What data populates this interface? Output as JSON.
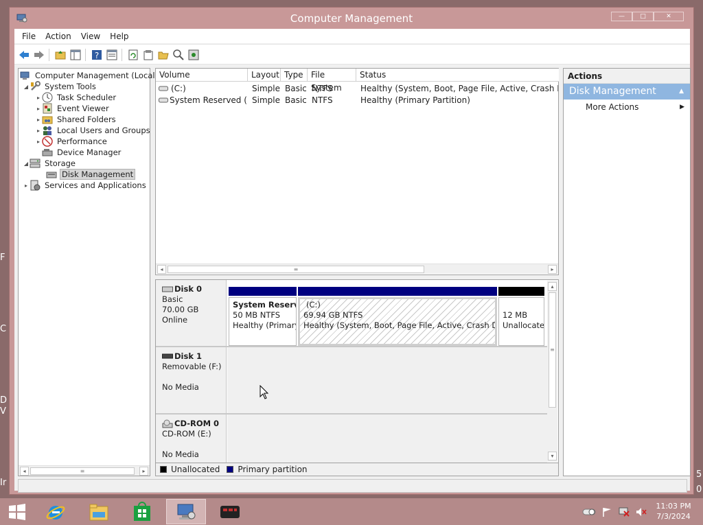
{
  "desktop": {
    "left_fragments": [
      "F",
      "C",
      "D",
      "V",
      "Ir"
    ],
    "right_fragments": [
      "5",
      "0"
    ]
  },
  "window": {
    "title": "Computer Management",
    "controls": {
      "minimize": "—",
      "maximize": "□",
      "close": "✕"
    }
  },
  "menu": [
    "File",
    "Action",
    "View",
    "Help"
  ],
  "toolbar": [
    "back-icon",
    "forward-icon",
    "up-folder-icon",
    "show-hide-tree-icon",
    "help-icon",
    "properties-list-icon",
    "refresh-icon",
    "properties-icon",
    "open-icon",
    "search-disk-icon",
    "settings-disk-icon"
  ],
  "tree": {
    "root": "Computer Management (Local)",
    "items": [
      {
        "label": "System Tools",
        "icon": "tools-icon"
      },
      {
        "label": "Task Scheduler",
        "icon": "clock-icon"
      },
      {
        "label": "Event Viewer",
        "icon": "event-viewer-icon"
      },
      {
        "label": "Shared Folders",
        "icon": "shared-folder-icon"
      },
      {
        "label": "Local Users and Groups",
        "icon": "users-icon"
      },
      {
        "label": "Performance",
        "icon": "performance-icon"
      },
      {
        "label": "Device Manager",
        "icon": "device-manager-icon"
      },
      {
        "label": "Storage",
        "icon": "storage-icon"
      },
      {
        "label": "Disk Management",
        "icon": "disk-management-icon"
      },
      {
        "label": "Services and Applications",
        "icon": "services-icon"
      }
    ]
  },
  "volumes": {
    "columns": [
      "Volume",
      "Layout",
      "Type",
      "File System",
      "Status"
    ],
    "rows": [
      {
        "volume": "(C:)",
        "layout": "Simple",
        "type": "Basic",
        "fs": "NTFS",
        "status": "Healthy (System, Boot, Page File, Active, Crash Dump, Primary Partition)"
      },
      {
        "volume": "System Reserved (D:)",
        "layout": "Simple",
        "type": "Basic",
        "fs": "NTFS",
        "status": "Healthy (Primary Partition)"
      }
    ]
  },
  "disks": [
    {
      "name": "Disk 0",
      "type": "Basic",
      "size": "70.00 GB",
      "state": "Online",
      "partitions": [
        {
          "title": "System Reserved",
          "size": "50 MB NTFS",
          "status": "Healthy (Primary Partition)"
        },
        {
          "title": "(C:)",
          "size": "69.94 GB NTFS",
          "status": "Healthy (System, Boot, Page File, Active, Crash Dump, Primary Partition)"
        },
        {
          "title": "",
          "size": "12 MB",
          "status": "Unallocated"
        }
      ]
    },
    {
      "name": "Disk 1",
      "type": "Removable (F:)",
      "size": "",
      "state": "No Media"
    },
    {
      "name": "CD-ROM 0",
      "type": "CD-ROM (E:)",
      "size": "",
      "state": "No Media"
    }
  ],
  "legend": [
    {
      "label": "Unallocated",
      "color": "#000000"
    },
    {
      "label": "Primary partition",
      "color": "#000080"
    }
  ],
  "actions": {
    "header": "Actions",
    "group": "Disk Management",
    "items": [
      "More Actions"
    ]
  },
  "taskbar": {
    "apps": [
      "start-icon",
      "internet-explorer-icon",
      "file-explorer-icon",
      "store-icon",
      "computer-management-icon",
      "media-app-icon"
    ],
    "tray": [
      "toggle-icon",
      "flag-icon",
      "network-icon",
      "volume-muted-icon"
    ],
    "time": "11:03 PM",
    "date": "7/3/2024"
  },
  "colors": {
    "primary_partition": "#000080",
    "unallocated": "#000000",
    "actions_header": "#8fb6e0",
    "window_frame": "#c89898"
  }
}
